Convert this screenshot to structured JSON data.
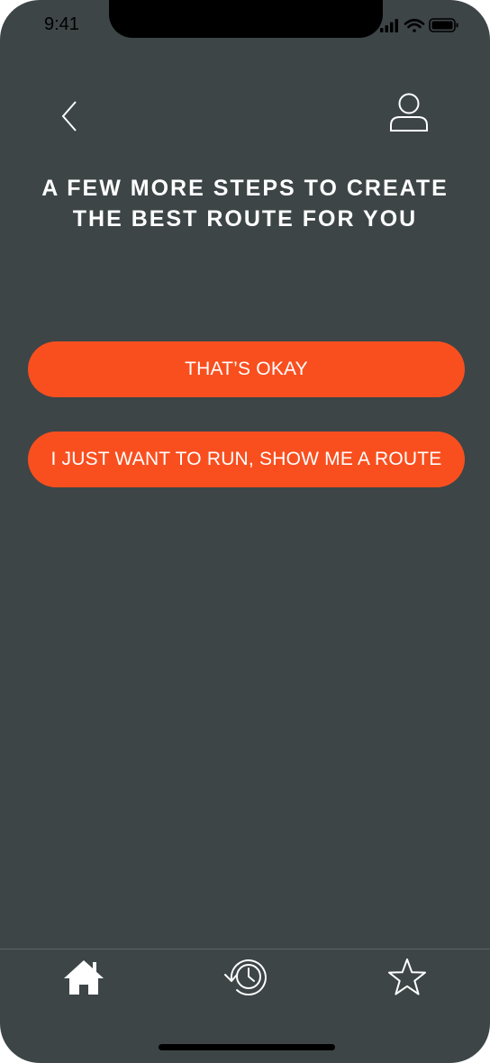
{
  "status_bar": {
    "time": "9:41"
  },
  "header": {
    "back_icon": "chevron-left-icon",
    "profile_icon": "user-icon"
  },
  "prompt": {
    "title": "A FEW MORE STEPS TO CREATE THE BEST ROUTE FOR YOU"
  },
  "actions": {
    "confirm_label": "THAT’S OKAY",
    "skip_label": "I JUST WANT TO RUN, SHOW ME A ROUTE"
  },
  "tab_bar": {
    "items": [
      {
        "icon": "home-icon",
        "selected": true
      },
      {
        "icon": "history-icon",
        "selected": false
      },
      {
        "icon": "star-icon",
        "selected": false
      }
    ]
  },
  "colors": {
    "background": "#3d4547",
    "accent": "#f94f1f",
    "text": "#ffffff"
  }
}
